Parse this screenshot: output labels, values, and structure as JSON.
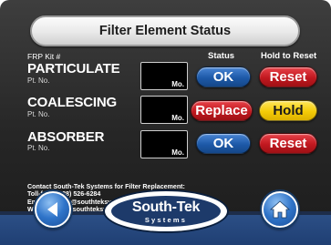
{
  "header": {
    "title": "Filter Element Status"
  },
  "columns": {
    "frp_kit": "FRP Kit #",
    "status": "Status",
    "hold_to_reset": "Hold to Reset"
  },
  "rows": [
    {
      "name": "PARTICULATE",
      "part_label": "Pt. No.",
      "month_label": "Mo.",
      "status": "OK",
      "status_color": "#1d59a8",
      "action": "Reset",
      "action_color": "#c1181f"
    },
    {
      "name": "COALESCING",
      "part_label": "Pt. No.",
      "month_label": "Mo.",
      "status": "Replace",
      "status_color": "#c1181f",
      "action": "Hold",
      "action_color": "#f4cb07"
    },
    {
      "name": "ABSORBER",
      "part_label": "Pt. No.",
      "month_label": "Mo.",
      "status": "OK",
      "status_color": "#1d59a8",
      "action": "Reset",
      "action_color": "#c1181f"
    }
  ],
  "contact": {
    "line1": "Contact South-Tek Systems for Filter Replacement:",
    "line2": "Toll-free: (888) 526-6284",
    "line3": "Email: service@southteksystems.com",
    "line4": "Website: www.southteksystems.com/shop"
  },
  "footer": {
    "back_icon": "back-arrow-icon",
    "home_icon": "home-icon",
    "logo_main": "South-Tek",
    "logo_sub": "Systems"
  }
}
